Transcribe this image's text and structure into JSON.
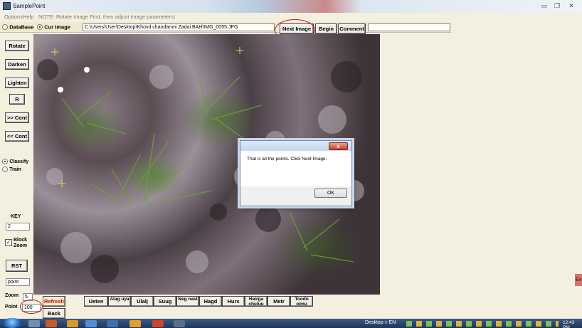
{
  "window": {
    "title": "SamplePoint",
    "controls": [
      "minimize",
      "restore",
      "close"
    ]
  },
  "menu": {
    "items": [
      "Options",
      "Help"
    ],
    "note": "NOTE: Rotate Image First, then adjust image parameters!"
  },
  "source": {
    "database_label": "DataBase",
    "current_image_label": "Cur Image",
    "selected": "Cur Image",
    "path_value": "C:\\Users\\User\\Desktop\\Khovd chandamni Zadai BAH\\IMG_0055.JPG",
    "comment_value": ""
  },
  "toolbar": {
    "next_image": "Next Image",
    "begin": "Begin",
    "comment": "Comment"
  },
  "side": {
    "rotate": "Rotate",
    "darken": "Darken",
    "lighten": "Lighten",
    "r": "R",
    "next_cont": ">> Cont",
    "prev_cont": "<< Cont",
    "classify": "Classify",
    "train": "Train",
    "mode_selected": "Classify",
    "key_label": "KEY",
    "key_value": "2",
    "block_zoom_label": "Block Zoom",
    "block_zoom_checked": true,
    "rst": "RST",
    "point_field": "point"
  },
  "dialog": {
    "close_label": "x",
    "message": "That is all the points.  Click Next Image.",
    "ok": "OK"
  },
  "bottom": {
    "zoom_label": "Zoom",
    "zoom_value": "5",
    "point_label": "Point",
    "point_value": "100",
    "refresh": "Refresh",
    "back": "Back",
    "categories": [
      "Ueten",
      "Alag uya",
      "Ulalj",
      "Suug",
      "Neg nast",
      "Hagd",
      "Hurs",
      "Hairga chuluu",
      "Metr",
      "Toodn oimu"
    ]
  },
  "taskbar": {
    "desktop_label": "Desktop",
    "chevron": "»",
    "language": "EN",
    "clock": "12:43 PM"
  },
  "edge_button": "Ex",
  "colors": {
    "app_background": "#f4f0e0",
    "annotation_ring": "#d01010",
    "taskbar": "#1e355a"
  }
}
